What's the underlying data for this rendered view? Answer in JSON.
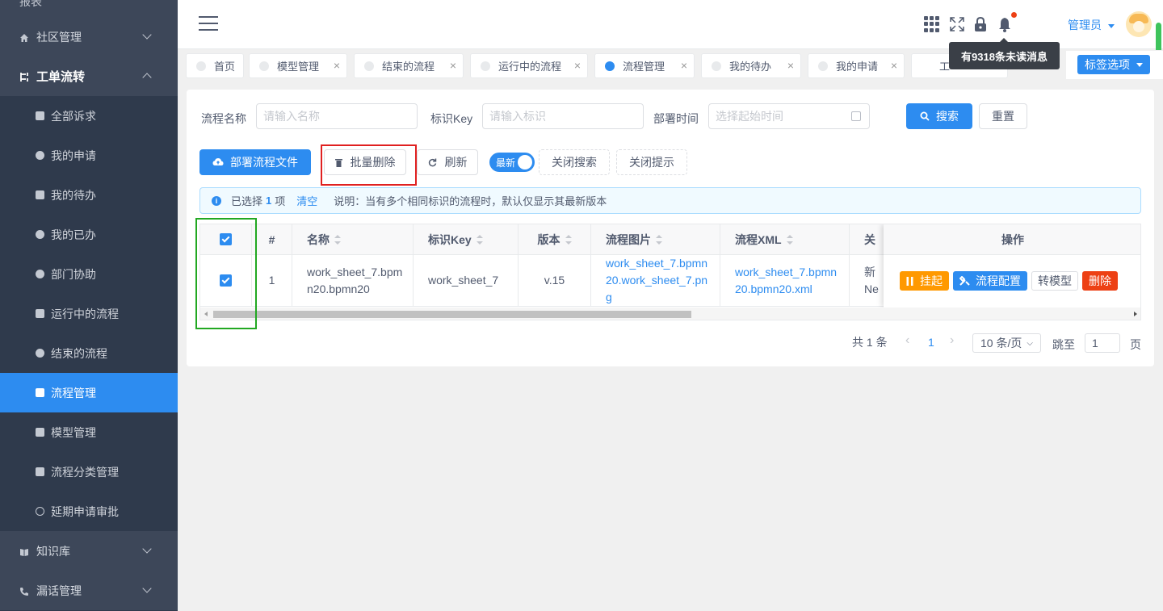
{
  "sidebar": {
    "top_partial": "报表",
    "groups": [
      {
        "label": "社区管理"
      },
      {
        "label": "工单流转"
      },
      {
        "label": "知识库"
      },
      {
        "label": "漏话管理"
      }
    ],
    "sub_items": [
      {
        "label": "全部诉求"
      },
      {
        "label": "我的申请"
      },
      {
        "label": "我的待办"
      },
      {
        "label": "我的已办"
      },
      {
        "label": "部门协助"
      },
      {
        "label": "运行中的流程"
      },
      {
        "label": "结束的流程"
      },
      {
        "label": "流程管理"
      },
      {
        "label": "模型管理"
      },
      {
        "label": "流程分类管理"
      },
      {
        "label": "延期申请审批"
      }
    ]
  },
  "header": {
    "user": "管理员",
    "tooltip": "有9318条未读消息"
  },
  "tabs": [
    {
      "label": "首页"
    },
    {
      "label": "模型管理"
    },
    {
      "label": "结束的流程"
    },
    {
      "label": "运行中的流程"
    },
    {
      "label": "流程管理"
    },
    {
      "label": "我的待办"
    },
    {
      "label": "我的申请"
    },
    {
      "label": "工"
    }
  ],
  "tab_select": "标签选项",
  "search": {
    "name_label": "流程名称",
    "name_placeholder": "请输入名称",
    "key_label": "标识Key",
    "key_placeholder": "请输入标识",
    "time_label": "部署时间",
    "time_placeholder": "选择起始时间",
    "search_btn": "搜索",
    "reset_btn": "重置"
  },
  "toolbar": {
    "deploy": "部署流程文件",
    "batch_delete": "批量删除",
    "refresh": "刷新",
    "switch": "最新",
    "close_search": "关闭搜索",
    "close_tip": "关闭提示"
  },
  "alert": {
    "selected_prefix": "已选择",
    "count": "1",
    "selected_suffix": "项",
    "clear": "清空",
    "note": "说明：当有多个相同标识的流程时，默认仅显示其最新版本"
  },
  "table": {
    "columns": [
      "#",
      "名称",
      "标识Key",
      "版本",
      "流程图片",
      "流程XML",
      "关",
      "操作"
    ],
    "rows": [
      {
        "index": "1",
        "name": "work_sheet_7.bpmn20.bpmn20",
        "key": "work_sheet_7",
        "version": "v.15",
        "image": "work_sheet_7.bpmn20.work_sheet_7.png",
        "xml": "work_sheet_7.bpmn20.bpmn20.xml",
        "related_top": "新",
        "related_bottom": "Ne"
      }
    ],
    "actions": {
      "suspend": "挂起",
      "config": "流程配置",
      "to_model": "转模型",
      "delete": "删除"
    }
  },
  "pagination": {
    "total": "共 1 条",
    "current": "1",
    "page_size": "10 条/页",
    "jump_label": "跳至",
    "jump_value": "1",
    "page_suffix": "页"
  },
  "colors": {
    "primary": "#2d8cf0",
    "sidebar": "#2f3a4c",
    "warning": "#ff9900",
    "danger": "#ed4014"
  }
}
